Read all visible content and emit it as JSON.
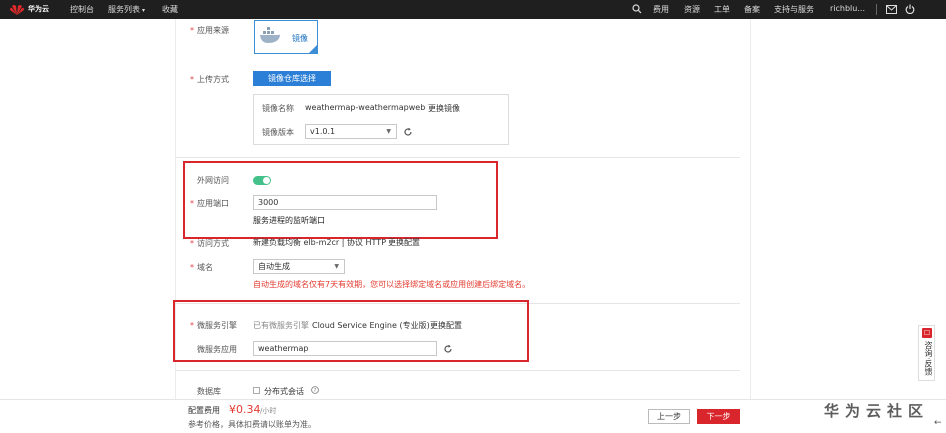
{
  "topbar": {
    "brand": "华为云",
    "nav_console": "控制台",
    "nav_services": "服务列表",
    "nav_favorites": "收藏",
    "nav_fees": "费用",
    "nav_resources": "资源",
    "nav_tickets": "工单",
    "nav_record": "备案",
    "nav_support": "支持与服务",
    "user": "richblu..."
  },
  "form": {
    "app_source_label": "应用来源",
    "image_card_label": "镜像",
    "upload_method_label": "上传方式",
    "repo_select_button": "镜像仓库选择",
    "image_name_label": "镜像名称",
    "image_name_value": "weathermap-weathermapweb",
    "change_image_link": "更换镜像",
    "image_version_label": "镜像版本",
    "image_version_value": "v1.0.1",
    "public_access_label": "外网访问",
    "public_access_on": true,
    "app_port_label": "应用端口",
    "app_port_value": "3000",
    "app_port_hint": "服务进程的监听端口",
    "access_mode_label": "访问方式",
    "access_mode_value": "新建负载均衡 elb-m2cr | 协议 HTTP",
    "change_config_link": "更换配置",
    "domain_label": "域名",
    "domain_value": "自动生成",
    "domain_warning": "自动生成的域名仅有7天有效期，您可以选择绑定域名或应用创建后绑定域名。",
    "microservice_engine_label": "微服务引擎",
    "microservice_engine_prefix": "已有微服务引擎",
    "microservice_engine_value": "Cloud Service Engine (专业版)",
    "microservice_change_link": "更换配置",
    "microservice_app_label": "微服务应用",
    "microservice_app_value": "weathermap",
    "database_label": "数据库",
    "distributed_session_label": "分布式会话"
  },
  "footer": {
    "fee_label": "配置费用",
    "fee_amount": "¥0.34",
    "fee_unit": "/小时",
    "fee_note": "参考价格，具体扣费请以账单为准。",
    "prev_button": "上一步",
    "next_button": "下一步",
    "watermark": "华为云社区"
  },
  "side": {
    "help_text": "咨询·反馈"
  },
  "colors": {
    "accent_blue": "#2b7fd6",
    "highlight_red": "#d9262c",
    "toggle_green": "#44c08a",
    "topbar_bg": "#1f1f1f"
  }
}
